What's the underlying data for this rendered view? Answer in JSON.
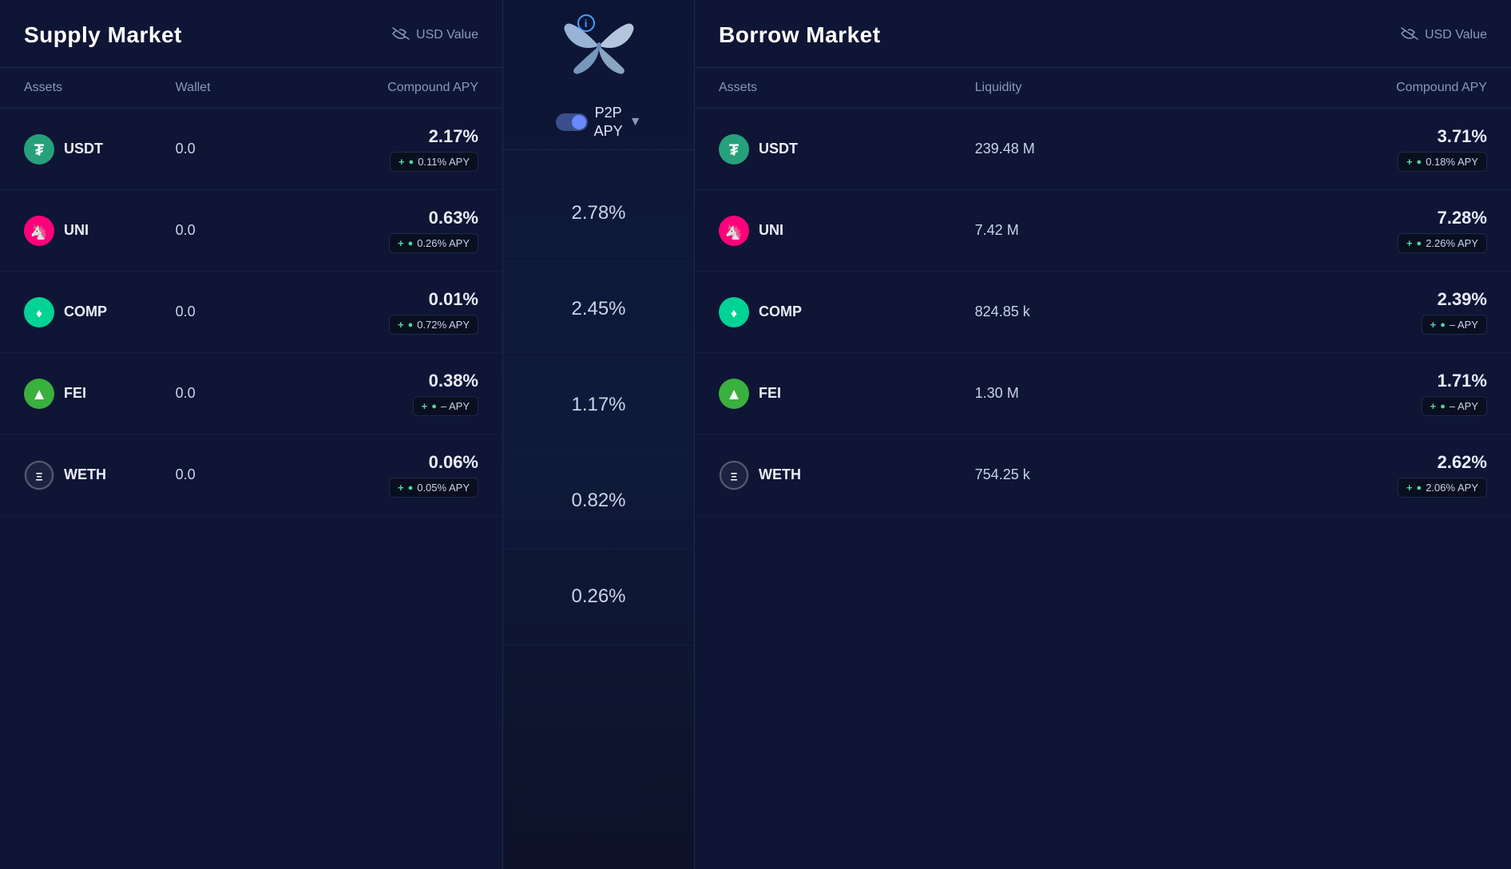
{
  "supply_market": {
    "title": "Supply Market",
    "usd_value_label": "USD Value",
    "columns": [
      "Assets",
      "Wallet",
      "Compound APY"
    ],
    "rows": [
      {
        "asset": "USDT",
        "icon_type": "usdt",
        "wallet": "0.0",
        "apy_main": "2.17%",
        "apy_badge": "+ 0.11% APY"
      },
      {
        "asset": "UNI",
        "icon_type": "uni",
        "wallet": "0.0",
        "apy_main": "0.63%",
        "apy_badge": "+ 0.26% APY"
      },
      {
        "asset": "COMP",
        "icon_type": "comp",
        "wallet": "0.0",
        "apy_main": "0.01%",
        "apy_badge": "+ 0.72% APY"
      },
      {
        "asset": "FEI",
        "icon_type": "fei",
        "wallet": "0.0",
        "apy_main": "0.38%",
        "apy_badge": "+ – APY"
      },
      {
        "asset": "WETH",
        "icon_type": "weth",
        "wallet": "0.0",
        "apy_main": "0.06%",
        "apy_badge": "+ 0.05% APY"
      }
    ]
  },
  "middle": {
    "info_label": "i",
    "p2p_label": "P2P\nAPY",
    "p2p_apy_values": [
      "2.78%",
      "2.45%",
      "1.17%",
      "0.82%",
      "0.26%"
    ]
  },
  "borrow_market": {
    "title": "Borrow Market",
    "usd_value_label": "USD Value",
    "columns": [
      "Assets",
      "Liquidity",
      "Compound APY"
    ],
    "rows": [
      {
        "asset": "USDT",
        "icon_type": "usdt",
        "liquidity": "239.48 M",
        "apy_main": "3.71%",
        "apy_badge": "+ 0.18% APY"
      },
      {
        "asset": "UNI",
        "icon_type": "uni",
        "liquidity": "7.42 M",
        "apy_main": "7.28%",
        "apy_badge": "+ 2.26% APY"
      },
      {
        "asset": "COMP",
        "icon_type": "comp",
        "liquidity": "824.85 k",
        "apy_main": "2.39%",
        "apy_badge": "+ – APY"
      },
      {
        "asset": "FEI",
        "icon_type": "fei",
        "liquidity": "1.30 M",
        "apy_main": "1.71%",
        "apy_badge": "+ – APY"
      },
      {
        "asset": "WETH",
        "icon_type": "weth",
        "liquidity": "754.25 k",
        "apy_main": "2.62%",
        "apy_badge": "+ 2.06% APY"
      }
    ]
  },
  "icons": {
    "usdt_symbol": "₮",
    "uni_symbol": "🦄",
    "comp_symbol": "♦",
    "fei_symbol": "▲",
    "weth_symbol": "Ξ",
    "eye_slash": "👁",
    "leaf": "🌿"
  }
}
